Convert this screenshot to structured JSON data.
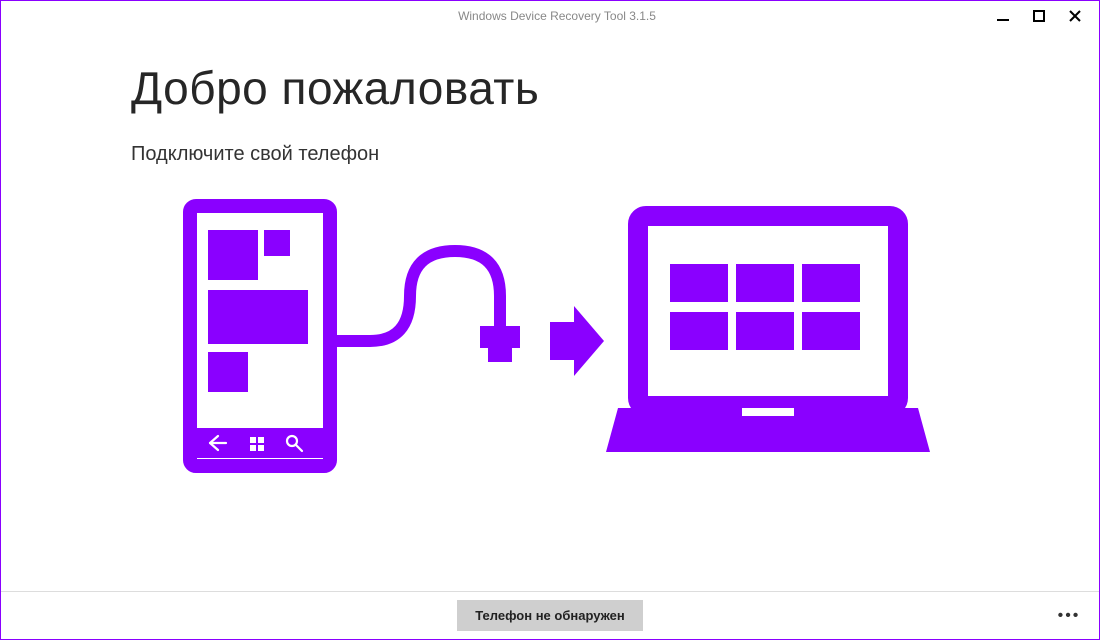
{
  "window": {
    "title": "Windows Device Recovery Tool 3.1.5"
  },
  "content": {
    "heading": "Добро пожаловать",
    "subtitle": "Подключите свой телефон"
  },
  "bottombar": {
    "primary_label": "Телефон не обнаружен",
    "more_label": "•••"
  },
  "colors": {
    "accent": "#8a00ff"
  }
}
